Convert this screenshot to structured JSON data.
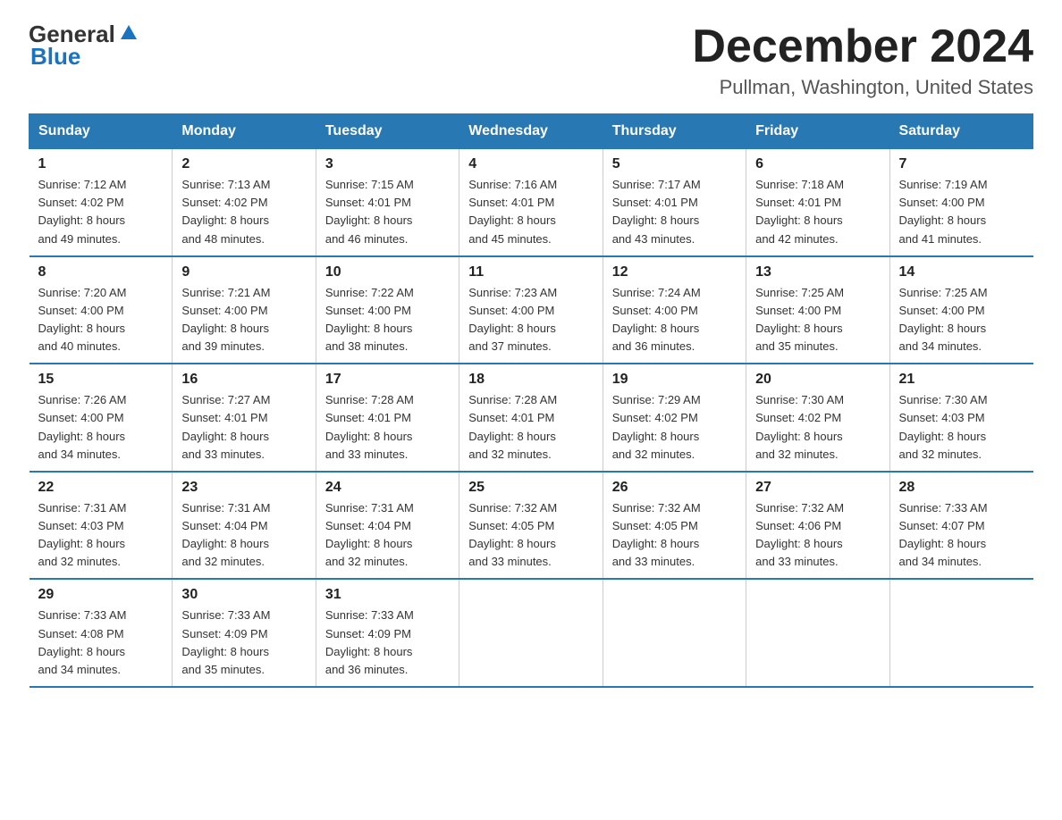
{
  "logo": {
    "text1": "General",
    "text2": "Blue"
  },
  "title": "December 2024",
  "subtitle": "Pullman, Washington, United States",
  "days_of_week": [
    "Sunday",
    "Monday",
    "Tuesday",
    "Wednesday",
    "Thursday",
    "Friday",
    "Saturday"
  ],
  "weeks": [
    [
      {
        "day": "1",
        "sunrise": "7:12 AM",
        "sunset": "4:02 PM",
        "daylight": "8 hours and 49 minutes."
      },
      {
        "day": "2",
        "sunrise": "7:13 AM",
        "sunset": "4:02 PM",
        "daylight": "8 hours and 48 minutes."
      },
      {
        "day": "3",
        "sunrise": "7:15 AM",
        "sunset": "4:01 PM",
        "daylight": "8 hours and 46 minutes."
      },
      {
        "day": "4",
        "sunrise": "7:16 AM",
        "sunset": "4:01 PM",
        "daylight": "8 hours and 45 minutes."
      },
      {
        "day": "5",
        "sunrise": "7:17 AM",
        "sunset": "4:01 PM",
        "daylight": "8 hours and 43 minutes."
      },
      {
        "day": "6",
        "sunrise": "7:18 AM",
        "sunset": "4:01 PM",
        "daylight": "8 hours and 42 minutes."
      },
      {
        "day": "7",
        "sunrise": "7:19 AM",
        "sunset": "4:00 PM",
        "daylight": "8 hours and 41 minutes."
      }
    ],
    [
      {
        "day": "8",
        "sunrise": "7:20 AM",
        "sunset": "4:00 PM",
        "daylight": "8 hours and 40 minutes."
      },
      {
        "day": "9",
        "sunrise": "7:21 AM",
        "sunset": "4:00 PM",
        "daylight": "8 hours and 39 minutes."
      },
      {
        "day": "10",
        "sunrise": "7:22 AM",
        "sunset": "4:00 PM",
        "daylight": "8 hours and 38 minutes."
      },
      {
        "day": "11",
        "sunrise": "7:23 AM",
        "sunset": "4:00 PM",
        "daylight": "8 hours and 37 minutes."
      },
      {
        "day": "12",
        "sunrise": "7:24 AM",
        "sunset": "4:00 PM",
        "daylight": "8 hours and 36 minutes."
      },
      {
        "day": "13",
        "sunrise": "7:25 AM",
        "sunset": "4:00 PM",
        "daylight": "8 hours and 35 minutes."
      },
      {
        "day": "14",
        "sunrise": "7:25 AM",
        "sunset": "4:00 PM",
        "daylight": "8 hours and 34 minutes."
      }
    ],
    [
      {
        "day": "15",
        "sunrise": "7:26 AM",
        "sunset": "4:00 PM",
        "daylight": "8 hours and 34 minutes."
      },
      {
        "day": "16",
        "sunrise": "7:27 AM",
        "sunset": "4:01 PM",
        "daylight": "8 hours and 33 minutes."
      },
      {
        "day": "17",
        "sunrise": "7:28 AM",
        "sunset": "4:01 PM",
        "daylight": "8 hours and 33 minutes."
      },
      {
        "day": "18",
        "sunrise": "7:28 AM",
        "sunset": "4:01 PM",
        "daylight": "8 hours and 32 minutes."
      },
      {
        "day": "19",
        "sunrise": "7:29 AM",
        "sunset": "4:02 PM",
        "daylight": "8 hours and 32 minutes."
      },
      {
        "day": "20",
        "sunrise": "7:30 AM",
        "sunset": "4:02 PM",
        "daylight": "8 hours and 32 minutes."
      },
      {
        "day": "21",
        "sunrise": "7:30 AM",
        "sunset": "4:03 PM",
        "daylight": "8 hours and 32 minutes."
      }
    ],
    [
      {
        "day": "22",
        "sunrise": "7:31 AM",
        "sunset": "4:03 PM",
        "daylight": "8 hours and 32 minutes."
      },
      {
        "day": "23",
        "sunrise": "7:31 AM",
        "sunset": "4:04 PM",
        "daylight": "8 hours and 32 minutes."
      },
      {
        "day": "24",
        "sunrise": "7:31 AM",
        "sunset": "4:04 PM",
        "daylight": "8 hours and 32 minutes."
      },
      {
        "day": "25",
        "sunrise": "7:32 AM",
        "sunset": "4:05 PM",
        "daylight": "8 hours and 33 minutes."
      },
      {
        "day": "26",
        "sunrise": "7:32 AM",
        "sunset": "4:05 PM",
        "daylight": "8 hours and 33 minutes."
      },
      {
        "day": "27",
        "sunrise": "7:32 AM",
        "sunset": "4:06 PM",
        "daylight": "8 hours and 33 minutes."
      },
      {
        "day": "28",
        "sunrise": "7:33 AM",
        "sunset": "4:07 PM",
        "daylight": "8 hours and 34 minutes."
      }
    ],
    [
      {
        "day": "29",
        "sunrise": "7:33 AM",
        "sunset": "4:08 PM",
        "daylight": "8 hours and 34 minutes."
      },
      {
        "day": "30",
        "sunrise": "7:33 AM",
        "sunset": "4:09 PM",
        "daylight": "8 hours and 35 minutes."
      },
      {
        "day": "31",
        "sunrise": "7:33 AM",
        "sunset": "4:09 PM",
        "daylight": "8 hours and 36 minutes."
      },
      null,
      null,
      null,
      null
    ]
  ],
  "labels": {
    "sunrise": "Sunrise:",
    "sunset": "Sunset:",
    "daylight": "Daylight:"
  }
}
